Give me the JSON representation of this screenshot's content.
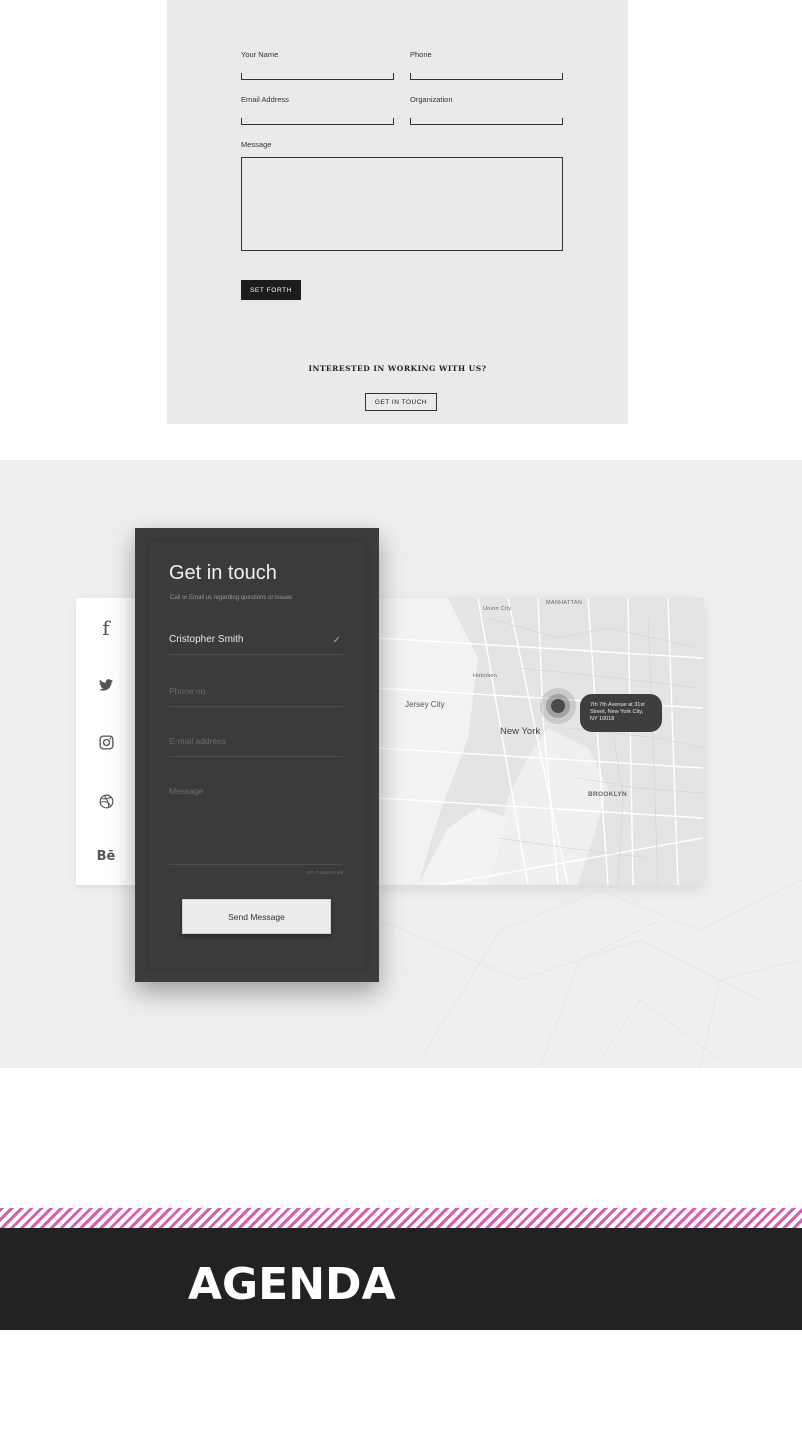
{
  "contact_form_light": {
    "your_name_label": "Your Name",
    "phone_label": "Phone",
    "email_label": "Email Address",
    "organization_label": "Organization",
    "message_label": "Message",
    "submit_label": "SET FORTH",
    "cta_heading": "INTERESTED IN WORKING WITH US?",
    "cta_button_label": "GET IN TOUCH"
  },
  "social_sidebar": {
    "icons": [
      {
        "name": "facebook-icon",
        "glyph": "f"
      },
      {
        "name": "twitter-icon",
        "glyph": "🐦"
      },
      {
        "name": "instagram-icon",
        "glyph": "◎"
      },
      {
        "name": "dribbble-icon",
        "glyph": "⊛"
      },
      {
        "name": "behance-icon",
        "glyph": "Bē"
      }
    ]
  },
  "contact_card_dark": {
    "title": "Get in touch",
    "subtitle": "Call or Email us regarding questions or issues",
    "name_value": "Cristopher Smith",
    "phone_placeholder": "Phone no.",
    "email_placeholder": "E-mail address",
    "message_placeholder": "Message",
    "char_count": "180 characters left",
    "send_label": "Send Message"
  },
  "map": {
    "labels": {
      "manhattan": "MANHATTAN",
      "jersey_city": "Jersey City",
      "new_york": "New York",
      "brooklyn": "BROOKLYN",
      "union_city": "Union City",
      "hoboken": "Hoboken"
    },
    "address": "7th 7th Avenue at 31st Street, New York City, NY 10018"
  },
  "agenda": {
    "title": "AGENDA"
  },
  "colors": {
    "stripe_accent": "#d65fb4",
    "dark_card": "#3c3d3f",
    "agenda_bar": "#222222"
  }
}
